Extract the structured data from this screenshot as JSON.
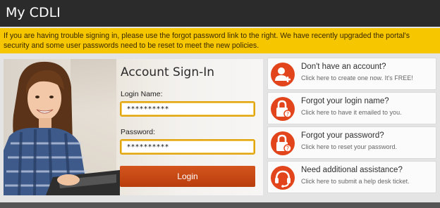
{
  "header": {
    "title": "My CDLI"
  },
  "alert": {
    "text": "If you are having trouble signing in, please use the forgot password link to the right. We have recently upgraded the portal's security and some user passwords need to be reset to meet the new policies."
  },
  "signin": {
    "heading": "Account Sign-In",
    "login_label": "Login Name:",
    "login_value": "**********",
    "password_label": "Password:",
    "password_value": "**********",
    "button_label": "Login"
  },
  "help_cards": [
    {
      "icon": "add-user-icon",
      "title": "Don't have an account?",
      "subtitle": "Click here to create one now. It's FREE!"
    },
    {
      "icon": "lock-question-icon",
      "title": "Forgot your login name?",
      "subtitle": "Click here to have it emailed to you."
    },
    {
      "icon": "lock-question-icon",
      "title": "Forgot your password?",
      "subtitle": "Click here to reset your password."
    },
    {
      "icon": "headset-icon",
      "title": "Need additional assistance?",
      "subtitle": "Click here to submit a help desk ticket."
    }
  ],
  "colors": {
    "accent": "#e2451b",
    "alert_bg": "#f6c600",
    "header_bg": "#2b2b2b",
    "field_border": "#e0a510"
  }
}
